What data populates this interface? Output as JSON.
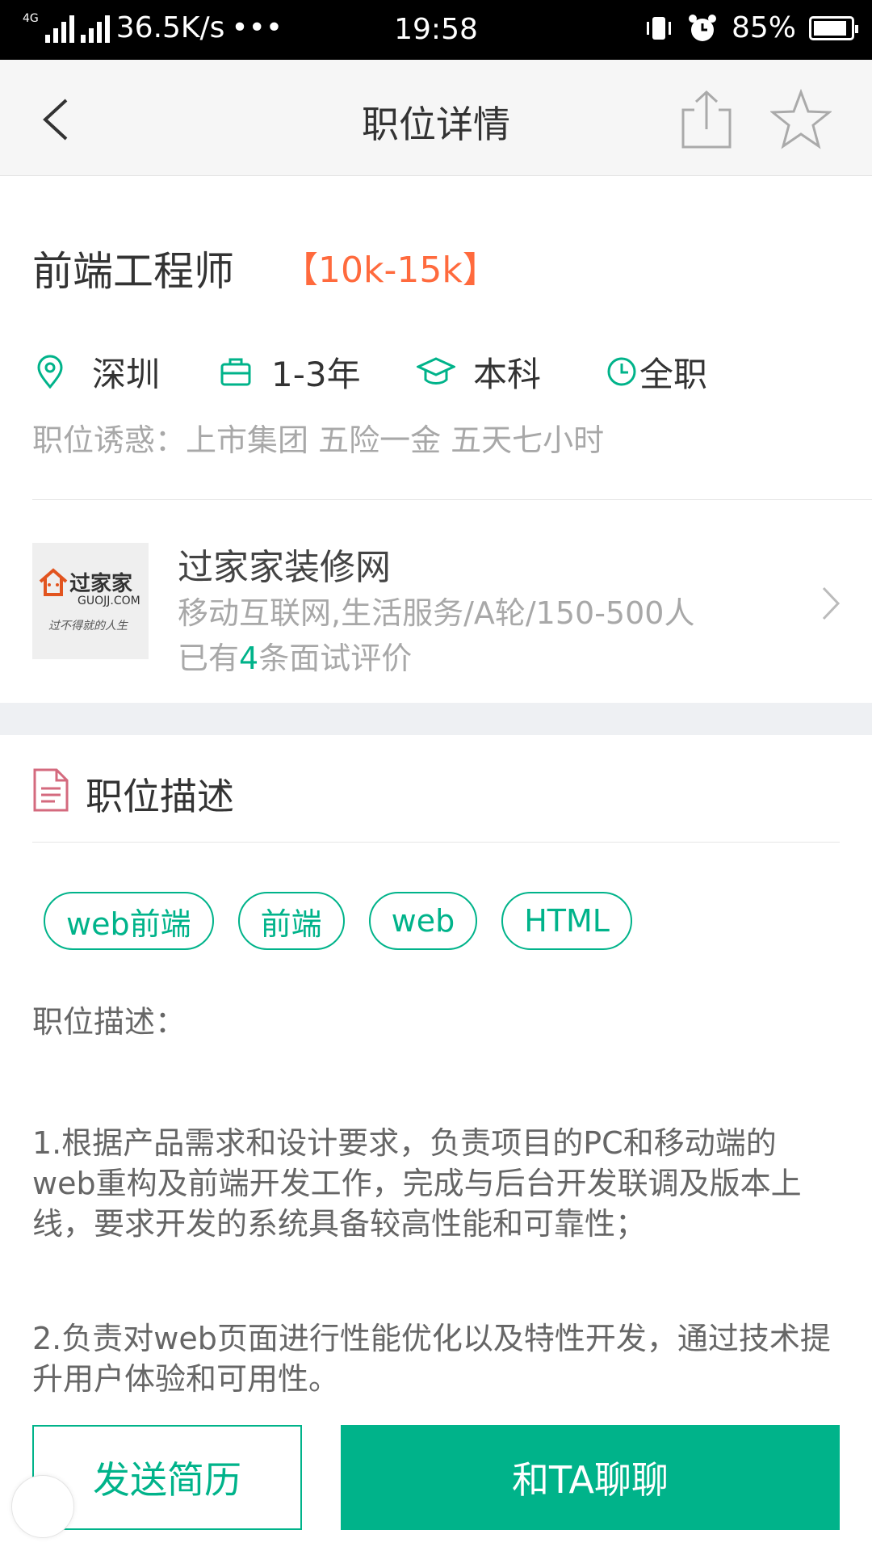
{
  "status_bar": {
    "network": "4G",
    "speed": "36.5K/s",
    "dots": "•••",
    "time": "19:58",
    "battery": "85%"
  },
  "header": {
    "title": "职位详情",
    "back_icon": "chevron-left-icon",
    "share_icon": "share-icon",
    "favorite_icon": "star-icon"
  },
  "job": {
    "title": "前端工程师",
    "salary": "【10k-15k】",
    "city": "深圳",
    "experience": "1-3年",
    "education": "本科",
    "type": "全职",
    "perks": "职位诱惑：上市集团 五险一金 五天七小时"
  },
  "company": {
    "logo_text": "过家家",
    "logo_domain": "GUOJJ.COM",
    "logo_slogan": "过不得就的人生",
    "name": "过家家装修网",
    "info": "移动互联网,生活服务/A轮/150-500人",
    "review_prefix": "已有",
    "review_count": "4",
    "review_suffix": "条面试评价"
  },
  "description": {
    "section_title": "职位描述",
    "tags": [
      "web前端",
      "前端",
      "web",
      "HTML"
    ],
    "heading": "职位描述：",
    "item1": "1.根据产品需求和设计要求，负责项目的PC和移动端的web重构及前端开发工作，完成与后台开发联调及版本上线，要求开发的系统具备较高性能和可靠性；",
    "item2": "2.负责对web页面进行性能优化以及特性开发，通过技术提升用户体验和可用性。"
  },
  "actions": {
    "send_resume": "发送简历",
    "chat": "和TA聊聊"
  },
  "colors": {
    "accent": "#00b38a",
    "salary": "#ff6a3d"
  }
}
